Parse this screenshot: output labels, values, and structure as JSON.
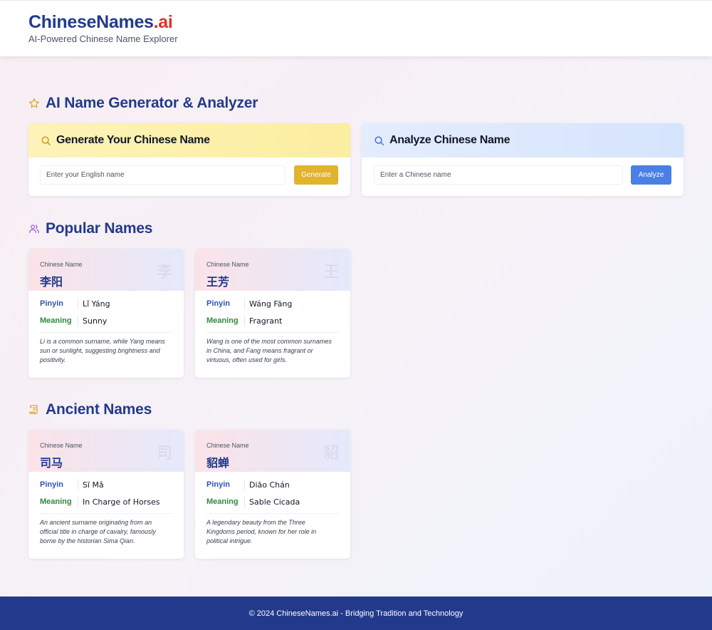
{
  "header": {
    "logo_main": "ChineseNames",
    "logo_suffix": ".ai",
    "tagline": "AI-Powered Chinese Name Explorer"
  },
  "sections": {
    "generator_title": "AI Name Generator & Analyzer",
    "popular_title": "Popular Names",
    "ancient_title": "Ancient Names"
  },
  "generator": {
    "title": "Generate Your Chinese Name",
    "placeholder": "Enter your English name",
    "button": "Generate"
  },
  "analyzer": {
    "title": "Analyze Chinese Name",
    "placeholder": "Enter a Chinese name",
    "button": "Analyze"
  },
  "card_labels": {
    "chinese_name": "Chinese Name",
    "pinyin": "Pinyin",
    "meaning": "Meaning"
  },
  "popular_names": [
    {
      "name": "李阳",
      "watermark": "李",
      "pinyin": "Lǐ Yáng",
      "meaning": "Sunny",
      "description": "Li is a common surname, while Yang means sun or sunlight, suggesting brightness and positivity."
    },
    {
      "name": "王芳",
      "watermark": "王",
      "pinyin": "Wáng Fāng",
      "meaning": "Fragrant",
      "description": "Wang is one of the most common surnames in China, and Fang means fragrant or virtuous, often used for girls."
    }
  ],
  "ancient_names": [
    {
      "name": "司马",
      "watermark": "司",
      "pinyin": "Sī Mǎ",
      "meaning": "In Charge of Horses",
      "description": "An ancient surname originating from an official title in charge of cavalry, famously borne by the historian Sima Qian."
    },
    {
      "name": "貂蝉",
      "watermark": "貂",
      "pinyin": "Diāo Chán",
      "meaning": "Sable Cicada",
      "description": "A legendary beauty from the Three Kingdoms period, known for her role in political intrigue."
    }
  ],
  "footer": {
    "text": "© 2024 ChineseNames.ai - Bridging Tradition and Technology"
  },
  "colors": {
    "brand_navy": "#233a8c",
    "brand_red": "#d8352a",
    "generate_button": "#e2b32c",
    "analyze_button": "#4a7fe6",
    "pinyin_label": "#2d53b8",
    "meaning_label": "#2f8a3f"
  },
  "icons": {
    "generator_section": "star-icon",
    "generate_panel": "search-icon",
    "analyze_panel": "search-icon",
    "popular_section": "users-icon",
    "ancient_section": "scroll-icon"
  }
}
